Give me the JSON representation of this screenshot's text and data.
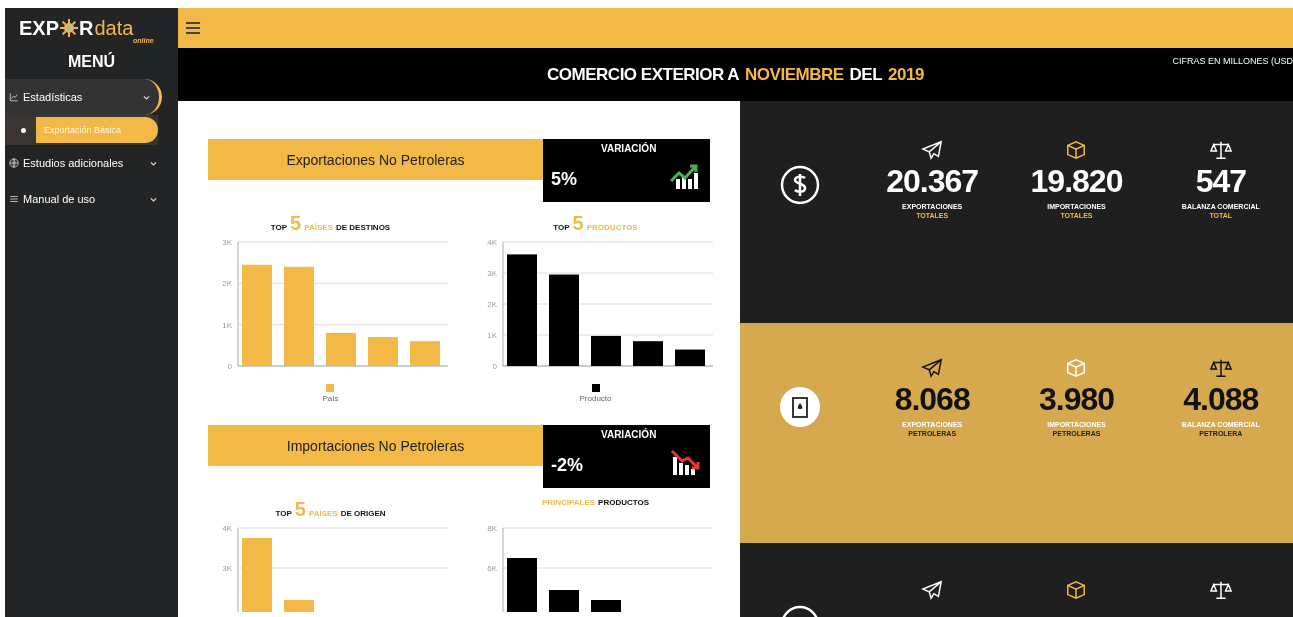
{
  "logo": {
    "parts": [
      "EXP",
      "R",
      "data"
    ],
    "tagline": "online"
  },
  "sidebar": {
    "title": "MENÚ",
    "items": [
      {
        "label": "Estadísticas",
        "expanded": true,
        "children": [
          {
            "label": "Exportación Básica",
            "selected": true
          }
        ]
      },
      {
        "label": "Estudios adicionales",
        "expanded": false
      },
      {
        "label": "Manual de uso",
        "expanded": false
      }
    ]
  },
  "header": {
    "title_parts": [
      {
        "text": "COMERCIO EXTERIOR A",
        "highlight": false
      },
      {
        "text": "NOVIEMBRE",
        "highlight": true
      },
      {
        "text": "DEL",
        "highlight": false
      },
      {
        "text": "2019",
        "highlight": true
      }
    ],
    "note": "CIFRAS EN MILLONES (USD"
  },
  "sections": [
    {
      "title": "Exportaciones No Petroleras",
      "variation": {
        "label": "VARIACIÓN",
        "value": "5%"
      },
      "charts": [
        {
          "title_parts": [
            {
              "text": "TOP",
              "kind": "plain"
            },
            {
              "text": "5",
              "kind": "number"
            },
            {
              "text": "PAÍSES",
              "kind": "accent"
            },
            {
              "text": "DE DESTINOS",
              "kind": "plain"
            }
          ],
          "chart_data": {
            "type": "bar",
            "grid": true,
            "ylim": [
              0,
              3000
            ],
            "yticks": [
              {
                "value": 3000,
                "label": "3K"
              },
              {
                "value": 2000,
                "label": "2K"
              },
              {
                "value": 1000,
                "label": "1K"
              },
              {
                "value": 0,
                "label": "0"
              }
            ],
            "series": [
              {
                "name": "País",
                "color": "#f3b946",
                "values": [
                  2450,
                  2400,
                  800,
                  700,
                  600
                ]
              }
            ]
          }
        },
        {
          "title_parts": [
            {
              "text": "TOP",
              "kind": "plain"
            },
            {
              "text": "5",
              "kind": "number"
            },
            {
              "text": "PRODUCTOS",
              "kind": "accent"
            }
          ],
          "chart_data": {
            "type": "bar",
            "grid": true,
            "ylim": [
              0,
              4000
            ],
            "yticks": [
              {
                "value": 4000,
                "label": "4K"
              },
              {
                "value": 3000,
                "label": "3K"
              },
              {
                "value": 2000,
                "label": "2K"
              },
              {
                "value": 1000,
                "label": "1K"
              },
              {
                "value": 0,
                "label": "0"
              }
            ],
            "series": [
              {
                "name": "Producto",
                "color": "#000000",
                "values": [
                  3600,
                  2950,
                  970,
                  800,
                  530
                ]
              }
            ]
          }
        }
      ]
    },
    {
      "title": "Importaciones No Petroleras",
      "variation": {
        "label": "VARIACIÓN",
        "value": "-2%"
      },
      "charts": [
        {
          "title_parts": [
            {
              "text": "TOP",
              "kind": "plain"
            },
            {
              "text": "5",
              "kind": "number"
            },
            {
              "text": "PAÍSES",
              "kind": "accent"
            },
            {
              "text": "DE ORIGEN",
              "kind": "plain"
            }
          ],
          "chart_data": {
            "type": "bar",
            "grid": true,
            "ylim": [
              1900,
              4000
            ],
            "yticks": [
              {
                "value": 4000,
                "label": "4K"
              },
              {
                "value": 3000,
                "label": "3K"
              }
            ],
            "series": [
              {
                "color": "#f3b946",
                "values": [
                  3750,
                  2200,
                  null,
                  null,
                  null
                ]
              }
            ]
          }
        },
        {
          "title_parts": [
            {
              "text": "PRINCIPALES",
              "kind": "accent"
            },
            {
              "text": "PRODUCTOS",
              "kind": "plain"
            }
          ],
          "chart_data": {
            "type": "bar",
            "grid": true,
            "ylim": [
              3800,
              8000
            ],
            "yticks": [
              {
                "value": 8000,
                "label": "8K"
              },
              {
                "value": 6000,
                "label": "6K"
              }
            ],
            "series": [
              {
                "color": "#000000",
                "values": [
                  6500,
                  4900,
                  4400,
                  null,
                  null
                ]
              }
            ]
          }
        }
      ]
    }
  ],
  "bands": [
    {
      "stats": [
        {
          "value": "20.367",
          "label": "EXPORTACIONES",
          "sublabel": "TOTALES"
        },
        {
          "value": "19.820",
          "label": "IMPORTACIONES",
          "sublabel": "TOTALES"
        },
        {
          "value": "547",
          "label": "BALANZA COMERCIAL",
          "sublabel": "TOTAL"
        }
      ]
    },
    {
      "stats": [
        {
          "value": "8.068",
          "label": "EXPORTACIONES",
          "sublabel": "PETROLERAS"
        },
        {
          "value": "3.980",
          "label": "IMPORTACIONES",
          "sublabel": "PETROLERAS"
        },
        {
          "value": "4.088",
          "label": "BALANZA COMERCIAL",
          "sublabel": "PETROLERA"
        }
      ]
    }
  ]
}
